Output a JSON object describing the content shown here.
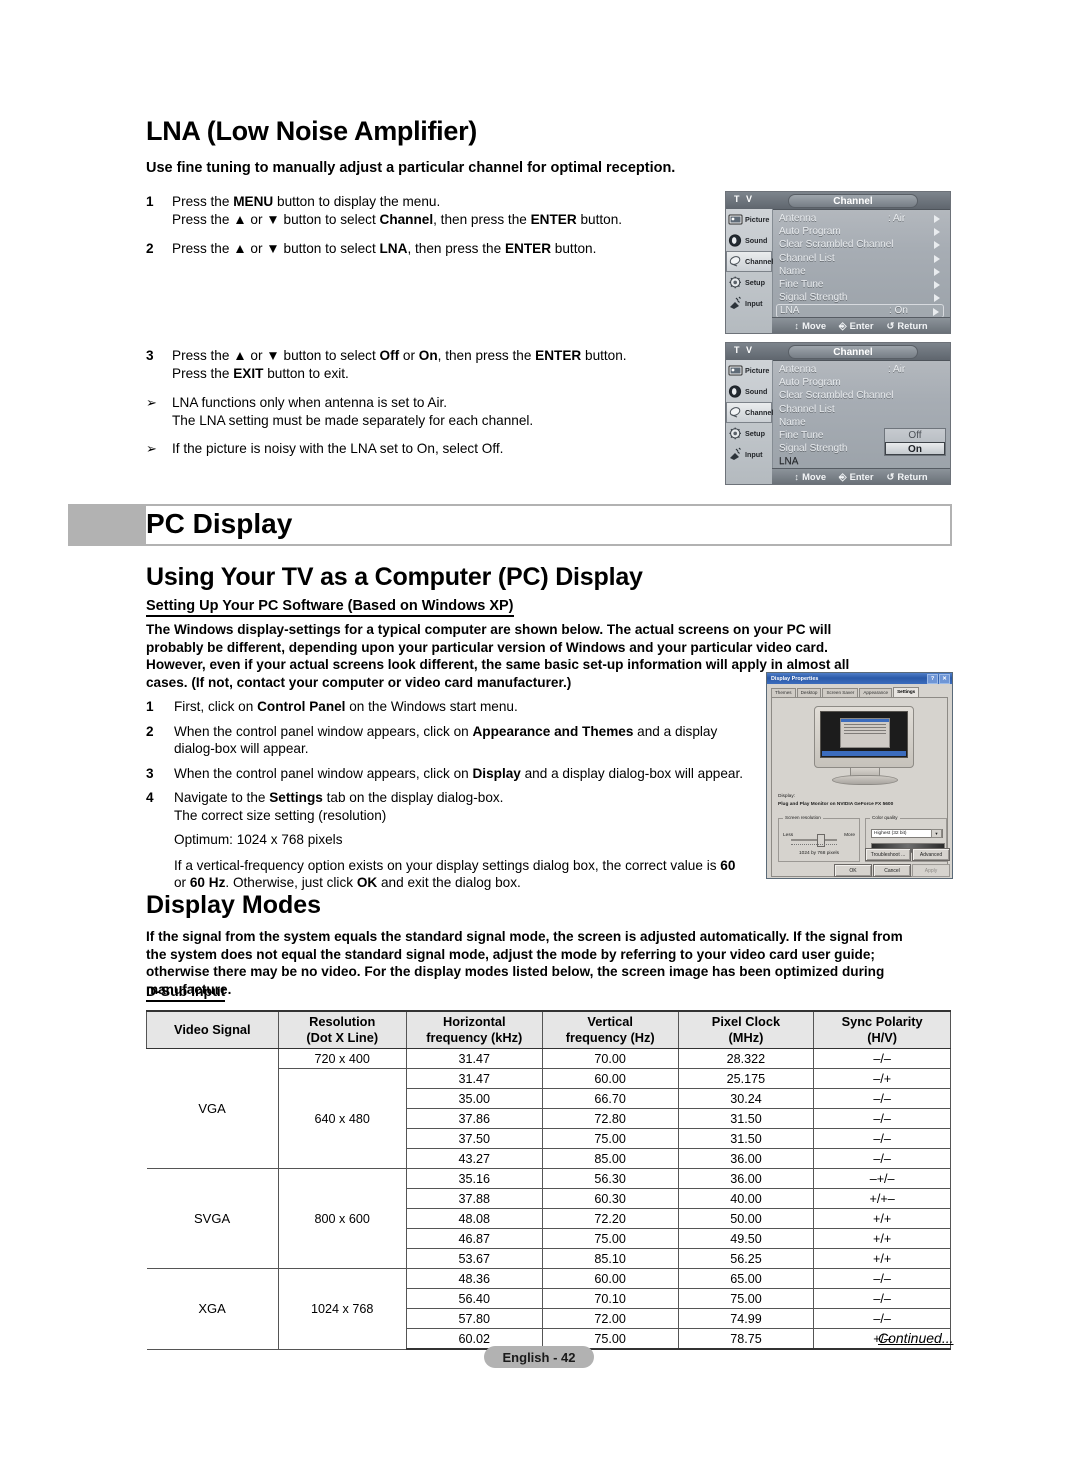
{
  "lna": {
    "title": "LNA (Low Noise Amplifier)",
    "subtitle": "Use fine tuning to manually adjust a particular channel for optimal reception.",
    "steps": [
      {
        "num": "1",
        "lines": [
          "Press the MENU button to display the menu.",
          "Press the ▲ or ▼ button to select Channel, then press the ENTER button."
        ]
      },
      {
        "num": "2",
        "lines": [
          "Press the ▲ or ▼ button to select LNA, then press the ENTER button."
        ]
      },
      {
        "num": "3",
        "lines": [
          "Press the ▲ or ▼ button to select Off or On, then press the ENTER button.",
          "Press the EXIT button to exit."
        ]
      }
    ],
    "step1_l1_pre": "Press the ",
    "step1_l1_b": "MENU",
    "step1_l1_post": " button to display the menu.",
    "step1_l2_a": "Press the ▲ or ▼ button to select ",
    "step1_l2_b1": "Channel",
    "step1_l2_c": ", then press the ",
    "step1_l2_b2": "ENTER",
    "step1_l2_d": " button.",
    "step2_a": "Press the ▲ or ▼ button to select ",
    "step2_b1": "LNA",
    "step2_c": ", then press the ",
    "step2_b2": "ENTER",
    "step2_d": " button.",
    "step3_a": "Press the ▲ or ▼ button to select ",
    "step3_b1": "Off",
    "step3_mid": " or ",
    "step3_b2": "On",
    "step3_c": ", then press the ",
    "step3_b3": "ENTER",
    "step3_d": " button.",
    "step3_l2_a": "Press the ",
    "step3_l2_b": "EXIT",
    "step3_l2_c": " button to exit.",
    "notes": [
      "LNA functions only when antenna is set to Air.",
      "The LNA setting must be made separately for each channel.",
      "If the picture is noisy with the LNA set to On, select Off."
    ],
    "note_mark": "➢"
  },
  "osd": {
    "tv_label": "T V",
    "title": "Channel",
    "side_items": [
      "Picture",
      "Sound",
      "Channel",
      "Setup",
      "Input"
    ],
    "menu_rows": [
      {
        "label": "Antenna",
        "value": ": Air"
      },
      {
        "label": "Auto Program",
        "value": ""
      },
      {
        "label": "Clear Scrambled Channel",
        "value": ""
      },
      {
        "label": "Channel List",
        "value": ""
      },
      {
        "label": "Name",
        "value": ""
      },
      {
        "label": "Fine Tune",
        "value": ""
      },
      {
        "label": "Signal Strength",
        "value": ""
      },
      {
        "label": "LNA",
        "value": ": On"
      }
    ],
    "bottom": {
      "move": "Move",
      "enter": "Enter",
      "return": "Return"
    },
    "popup_options": [
      "Off",
      "On"
    ],
    "selected_option": "On"
  },
  "pc_display": {
    "banner_title": "PC Display",
    "h2": "Using Your TV as a Computer (PC) Display",
    "h3": "Setting Up Your PC Software (Based on Windows XP)",
    "intro": "The Windows display-settings for a typical computer are shown below. The actual screens on your PC will probably be different, depending upon your particular version of Windows and your particular video card. However, even if your actual screens look different, the same basic set-up information will apply in almost all cases. (If not, contact your computer or video card manufacturer.)",
    "step1_a": "First, click on ",
    "step1_b": "Control Panel",
    "step1_c": " on the Windows start menu.",
    "step2_a": "When the control panel window appears, click on ",
    "step2_b": "Appearance and Themes",
    "step2_c": " and a display dialog-box will appear.",
    "step3_a": "When the control panel window appears, click on ",
    "step3_b": "Display",
    "step3_c": " and a display dialog-box will appear.",
    "step4_a": "Navigate to the ",
    "step4_b": "Settings",
    "step4_c": " tab on the display dialog-box.",
    "step4_l2": "The correct size setting (resolution)",
    "optimum": "Optimum: 1024 x 768 pixels",
    "vfreq_a": "If a vertical-frequency option exists on your display settings dialog box, the correct value is ",
    "vfreq_b1": "60",
    "vfreq_mid": " or ",
    "vfreq_b2": "60 Hz",
    "vfreq_c": ". Otherwise, just click ",
    "vfreq_b3": "OK",
    "vfreq_d": " and exit the dialog box.",
    "step_nums": [
      "1",
      "2",
      "3",
      "4"
    ]
  },
  "dialog": {
    "title": "Display Properties",
    "help_btn": "?",
    "close_btn": "✕",
    "tabs": [
      "Themes",
      "Desktop",
      "Screen Saver",
      "Appearance",
      "Settings"
    ],
    "active_tab": "Settings",
    "display_label": "Display:",
    "display_value": "Plug and Play Monitor on NVIDIA GeForce FX 5600",
    "screen_res_caption": "Screen resolution",
    "less_label": "Less",
    "more_label": "More",
    "resolution_text": "1024 by 768 pixels",
    "color_quality_caption": "Color quality",
    "color_quality_value": "Highest (32 bit)",
    "troubleshoot_btn": "Troubleshoot ...",
    "advanced_btn": "Advanced",
    "ok_btn": "OK",
    "cancel_btn": "Cancel",
    "apply_btn": "Apply"
  },
  "display_modes": {
    "h2": "Display Modes",
    "intro": "If the signal from the system equals the standard signal mode, the screen is adjusted automatically. If the signal from the system does not equal the standard signal mode, adjust the mode by referring to your video card user guide; otherwise there may be no video. For the display modes listed below, the screen image has been optimized during manufacture.",
    "h3": "D-Sub Input"
  },
  "table": {
    "headers": [
      {
        "l1": "Video Signal",
        "l2": ""
      },
      {
        "l1": "Resolution",
        "l2": "(Dot X Line)"
      },
      {
        "l1": "Horizontal",
        "l2": "frequency (kHz)"
      },
      {
        "l1": "Vertical",
        "l2": "frequency (Hz)"
      },
      {
        "l1": "Pixel Clock",
        "l2": "(MHz)"
      },
      {
        "l1": "Sync Polarity",
        "l2": "(H/V)"
      }
    ],
    "groups": [
      {
        "signal": "VGA",
        "resolutions": [
          {
            "res": "720 x 400",
            "rows": [
              [
                "31.47",
                "70.00",
                "28.322",
                "–/–"
              ]
            ]
          },
          {
            "res": "640 x 480",
            "rows": [
              [
                "31.47",
                "60.00",
                "25.175",
                "–/+"
              ],
              [
                "35.00",
                "66.70",
                "30.24",
                "–/–"
              ],
              [
                "37.86",
                "72.80",
                "31.50",
                "–/–"
              ],
              [
                "37.50",
                "75.00",
                "31.50",
                "–/–"
              ],
              [
                "43.27",
                "85.00",
                "36.00",
                "–/–"
              ]
            ]
          }
        ]
      },
      {
        "signal": "SVGA",
        "resolutions": [
          {
            "res": "800 x 600",
            "rows": [
              [
                "35.16",
                "56.30",
                "36.00",
                "–+/–"
              ],
              [
                "37.88",
                "60.30",
                "40.00",
                "+/+–"
              ],
              [
                "48.08",
                "72.20",
                "50.00",
                "+/+"
              ],
              [
                "46.87",
                "75.00",
                "49.50",
                "+/+"
              ],
              [
                "53.67",
                "85.10",
                "56.25",
                "+/+"
              ]
            ]
          }
        ]
      },
      {
        "signal": "XGA",
        "resolutions": [
          {
            "res": "1024 x 768",
            "rows": [
              [
                "48.36",
                "60.00",
                "65.00",
                "–/–"
              ],
              [
                "56.40",
                "70.10",
                "75.00",
                "–/–"
              ],
              [
                "57.80",
                "72.00",
                "74.99",
                "–/–"
              ],
              [
                "60.02",
                "75.00",
                "78.75",
                "+/–"
              ]
            ]
          }
        ]
      }
    ]
  },
  "footer": {
    "page_label": "English - 42",
    "continued": "Continued..."
  }
}
